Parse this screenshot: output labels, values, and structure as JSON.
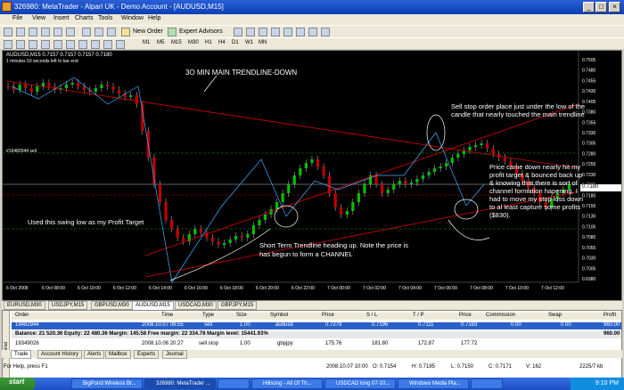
{
  "window": {
    "title": "326980: MetaTrader - Alpari UK - Demo Account - [AUDUSD,M15]",
    "minimize": "_",
    "maximize": "□",
    "close": "×"
  },
  "menu": [
    "File",
    "View",
    "Insert",
    "Charts",
    "Tools",
    "Window",
    "Help"
  ],
  "toolbar": {
    "new_order": "New Order",
    "expert_advisors": "Expert Advisors",
    "timeframes": [
      "M1",
      "M5",
      "M15",
      "M30",
      "H1",
      "H4",
      "D1",
      "W1",
      "MN"
    ]
  },
  "chart": {
    "header_line1": "AUDUSD,M15  0.7157 0.7157 0.7157 0.7180",
    "header_line2": "1 minutes 53 seconds left to bar end",
    "sell_label": "#19482944 sell",
    "price_labels": [
      "0.7505",
      "0.7480",
      "0.7455",
      "0.7430",
      "0.7405",
      "0.7380",
      "0.7355",
      "0.7330",
      "0.7305",
      "0.7280",
      "0.7255",
      "0.7230",
      "0.7205",
      "0.7180",
      "0.7155",
      "0.7130",
      "0.7105",
      "0.7080",
      "0.7055",
      "0.7030",
      "0.7005",
      "0.6980"
    ],
    "time_labels": [
      "6 Oct 2008",
      "6 Oct 08:00",
      "6 Oct 10:00",
      "6 Oct 12:00",
      "6 Oct 14:00",
      "6 Oct 16:00",
      "6 Oct 18:00",
      "6 Oct 20:00",
      "6 Oct 22:00",
      "7 Oct 00:00",
      "7 Oct 02:00",
      "7 Oct 04:00",
      "7 Oct 06:00",
      "7 Oct 08:00",
      "7 Oct 10:00",
      "7 Oct 12:00"
    ],
    "current_price": "0.7180",
    "annotations": {
      "main_trendline": "3O MIN MAIN TRENDLINE-DOWN",
      "sell_stop": "Sell stop order place just under the low of the candle that  nearly touched the main trendline",
      "price_came_down": "Price came down nearly hit my profit target & bounced back up & knowing that there is sort of channel formation hapening, I had to move my stop loss down to al least capture some profits ($830).",
      "swing_low": "Used this  swing low as my Profit Target",
      "short_term": "Short Term Trendline  heading up. Note the price is has begun to form a CHANNEL"
    }
  },
  "chart_tabs": [
    "EURUSD,M30",
    "USDJPY,M15",
    "GBPUSD,M30",
    "AUDUSD,M15",
    "USDCAD,M30",
    "GBPJPY,M15"
  ],
  "active_chart_tab": "AUDUSD,M15",
  "terminal": {
    "headers": [
      "Order",
      "Time",
      "Type",
      "Size",
      "Symbol",
      "Price",
      "S / L",
      "T / P",
      "Price",
      "Commission",
      "Swap",
      "Profit"
    ],
    "rows": [
      [
        "19482944",
        "2008.10.07 09:55",
        "sell",
        "1.00",
        "audusd",
        "0.7279",
        "0.7196",
        "0.7111",
        "0.7183",
        "0.00",
        "0.00",
        "960.00"
      ]
    ],
    "balance_line": "Balance: 21 520.36  Equity: 22 480.36  Margin: 145.58  Free margin: 22 334.78  Margin level: 15441.93%",
    "balance_profit": "960.00",
    "pending": [
      "19349026",
      "2008.10.06 20:27",
      "sell stop",
      "1.00",
      "gbpjpy",
      "175.76",
      "181.80",
      "172.87",
      "177.72",
      "",
      "",
      ""
    ],
    "side_label": "Terminal"
  },
  "bottom_tabs": [
    "Trade",
    "Account History",
    "Alerts",
    "Mailbox",
    "Experts",
    "Journal"
  ],
  "status": {
    "help": "For Help, press F1",
    "time": "2008.10.07 10:00",
    "open": "O: 0.7154",
    "high": "H: 0.7185",
    "low": "L: 0.7150",
    "close": "C: 0.7171",
    "volume": "V: 162",
    "traffic": "2225/7 kb"
  },
  "taskbar": {
    "start": "start",
    "items": [
      "BigPond Wireless Br...",
      "326980: MetaTrader ...",
      "",
      "Hillsong - All Of Th...",
      "USDCAD long 07-10...",
      "Windows Media Pla...",
      ""
    ],
    "clock": "9:10 PM"
  }
}
